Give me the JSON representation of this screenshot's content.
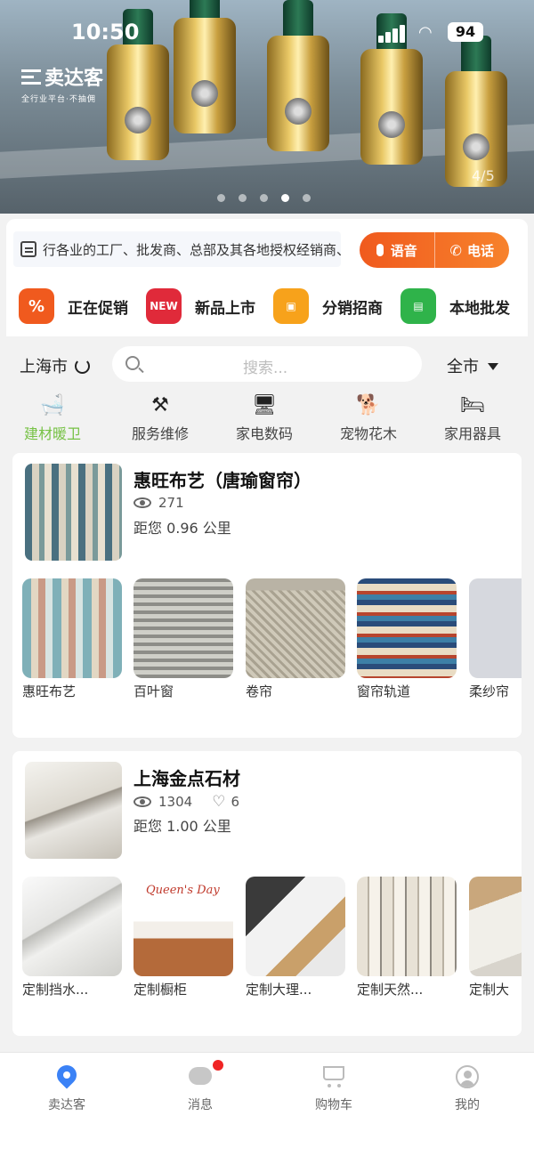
{
  "status_bar": {
    "time": "10:50",
    "battery": "94"
  },
  "banner": {
    "logo_text": "卖达客",
    "logo_slogan": "全行业平台·不抽佣",
    "pager": "4/5"
  },
  "notice": {
    "text": "行各业的工厂、批发商、总部及其各地授权经销商、个"
  },
  "actions": {
    "voice_label": "语音",
    "phone_label": "电话"
  },
  "shortcuts": [
    {
      "label": "正在促销",
      "icon": "percent-icon",
      "color": "#f05a1e",
      "glyph": "%"
    },
    {
      "label": "新品上市",
      "icon": "new-icon",
      "color": "#e02a3a",
      "glyph": "NEW"
    },
    {
      "label": "分销招商",
      "icon": "briefcase-icon",
      "color": "#f7a21b",
      "glyph": "▣"
    },
    {
      "label": "本地批发",
      "icon": "register-icon",
      "color": "#2fb34a",
      "glyph": "▤"
    }
  ],
  "search": {
    "city": "上海市",
    "placeholder": "搜索...",
    "region": "全市"
  },
  "categories": [
    {
      "label": "建材暖卫",
      "icon": "bathtub-icon",
      "glyph": "🛁",
      "active": true
    },
    {
      "label": "服务维修",
      "icon": "tools-icon",
      "glyph": "⚒",
      "active": false
    },
    {
      "label": "家电数码",
      "icon": "monitor-icon",
      "glyph": "🖥",
      "active": false
    },
    {
      "label": "宠物花木",
      "icon": "dog-icon",
      "glyph": "🐕",
      "active": false
    },
    {
      "label": "家用器具",
      "icon": "bed-icon",
      "glyph": "🛏",
      "active": false
    }
  ],
  "shops": [
    {
      "name": "惠旺布艺（唐瑜窗帘）",
      "views": "271",
      "distance": "距您 0.96 公里",
      "products": [
        "惠旺布艺",
        "百叶窗",
        "卷帘",
        "窗帘轨道",
        "柔纱帘"
      ]
    },
    {
      "name": "上海金点石材",
      "views": "1304",
      "likes": "6",
      "distance": "距您 1.00 公里",
      "products": [
        "定制挡水...",
        "定制橱柜",
        "定制大理...",
        "定制天然...",
        "定制大"
      ],
      "promo_text": "Queen's Day"
    }
  ],
  "tabbar": [
    {
      "label": "卖达客",
      "icon": "location-pin-icon"
    },
    {
      "label": "消息",
      "icon": "chat-bubble-icon"
    },
    {
      "label": "购物车",
      "icon": "cart-icon"
    },
    {
      "label": "我的",
      "icon": "user-icon"
    }
  ],
  "colors": {
    "accent_orange": "#f05a1e",
    "active_green": "#77c246",
    "nav_blue": "#3b82f6"
  }
}
